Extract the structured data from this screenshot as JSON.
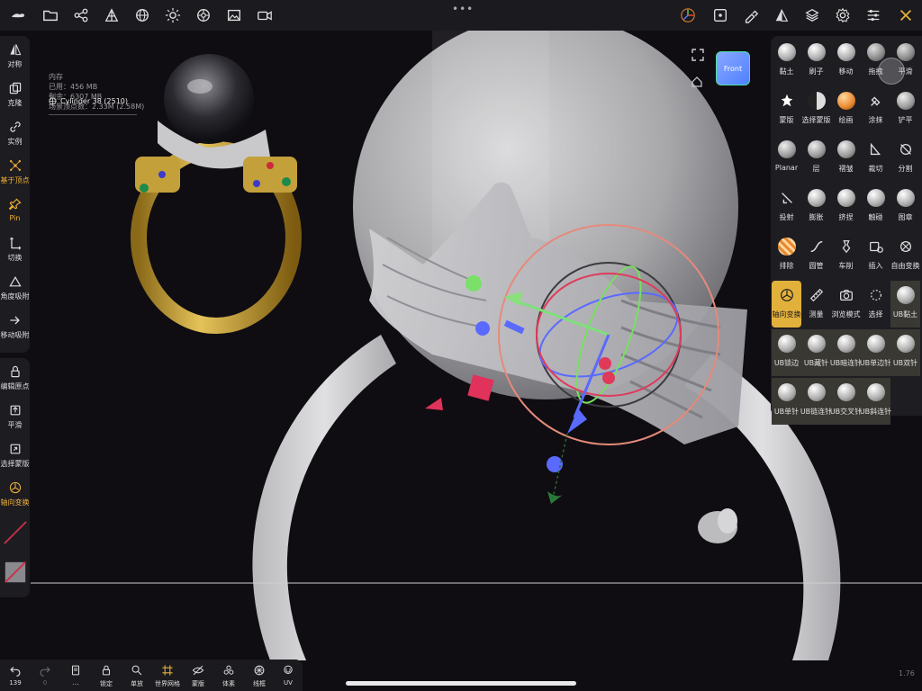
{
  "info": {
    "memory_label": "内存",
    "used": "已用：456 MB",
    "remaining": "剩余：6307 MB",
    "vertices": "场景顶点数：2.33M (2.58M)",
    "object_name": "Cylinder 38 (2510)"
  },
  "viewcube": {
    "label": "Front"
  },
  "left_toolbar": [
    {
      "label": "对称",
      "icon": "symmetry-icon"
    },
    {
      "label": "克隆",
      "icon": "clone-icon"
    },
    {
      "label": "实例",
      "icon": "instance-link-icon"
    },
    {
      "label": "基于顶点",
      "icon": "vertex-icon",
      "active": true
    },
    {
      "label": "Pin",
      "icon": "pin-icon",
      "active": true
    },
    {
      "label": "切换",
      "icon": "toggle-icon"
    },
    {
      "label": "角度吸附",
      "icon": "angle-snap-icon"
    },
    {
      "label": "移动吸附",
      "icon": "move-snap-icon"
    }
  ],
  "left_toolbar2": [
    {
      "label": "编辑原点",
      "icon": "lock-icon"
    },
    {
      "label": "平滑",
      "icon": "smooth-icon"
    },
    {
      "label": "选择蒙版",
      "icon": "select-mask-icon"
    },
    {
      "label": "轴向变换",
      "icon": "axis-transform-icon"
    }
  ],
  "brushes": [
    [
      "黏土",
      "刷子",
      "移动",
      "拖拽",
      "平滑"
    ],
    [
      "蒙版",
      "选择蒙版",
      "绘画",
      "涂抹",
      "铲平"
    ],
    [
      "Planar",
      "层",
      "褶皱",
      "裁切",
      "分割"
    ],
    [
      "投射",
      "膨胀",
      "挤捏",
      "触碰",
      "图章"
    ],
    [
      "排除",
      "圆管",
      "车削",
      "插入",
      "自由变换"
    ],
    [
      "轴向变换",
      "测量",
      "浏览模式",
      "选择",
      "UB黏土"
    ],
    [
      "UB锁边",
      "UB藏针",
      "UB暗连针",
      "UB单边针",
      "UB双针"
    ],
    [
      "UB单针",
      "UB链连针",
      "UB交叉针",
      "UB斜连针",
      ""
    ]
  ],
  "bottom_bar": [
    {
      "label": "139",
      "icon": "undo-icon"
    },
    {
      "label": "0",
      "icon": "redo-icon"
    },
    {
      "label": "…",
      "icon": "layers-icon"
    },
    {
      "label": "锁定",
      "icon": "lock-icon"
    },
    {
      "label": "单放",
      "icon": "magnify-icon"
    },
    {
      "label": "世界网格",
      "icon": "grid-icon",
      "active": true
    },
    {
      "label": "蒙版",
      "icon": "mask-eye-icon"
    },
    {
      "label": "体素",
      "icon": "voxel-icon"
    },
    {
      "label": "线框",
      "icon": "wireframe-icon"
    },
    {
      "label": "UV",
      "icon": "uv-icon"
    }
  ],
  "version": "1.76"
}
